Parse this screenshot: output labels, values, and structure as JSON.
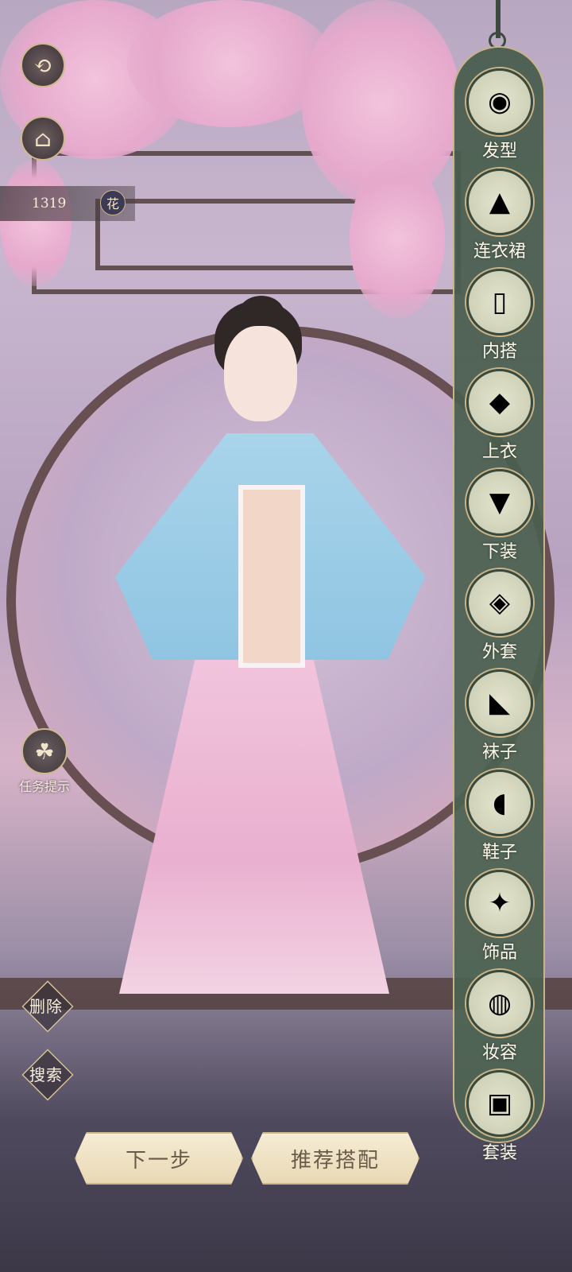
{
  "currency": {
    "amount": "1319",
    "icon_char": "花"
  },
  "left_controls": {
    "back_icon": "⟲",
    "shop_icon": "⌂"
  },
  "task_hint": {
    "label": "任务提示",
    "icon": "clover-icon"
  },
  "actions": {
    "delete": "删除",
    "search": "搜索"
  },
  "categories": [
    {
      "label": "发型",
      "icon": "hairstyle-icon",
      "glyph": "◉"
    },
    {
      "label": "连衣裙",
      "icon": "dress-icon",
      "glyph": "▲"
    },
    {
      "label": "内搭",
      "icon": "inner-wear-icon",
      "glyph": "▯"
    },
    {
      "label": "上衣",
      "icon": "top-icon",
      "glyph": "◆"
    },
    {
      "label": "下装",
      "icon": "skirt-icon",
      "glyph": "▼"
    },
    {
      "label": "外套",
      "icon": "coat-icon",
      "glyph": "◈"
    },
    {
      "label": "袜子",
      "icon": "socks-icon",
      "glyph": "◣"
    },
    {
      "label": "鞋子",
      "icon": "shoes-icon",
      "glyph": "◖"
    },
    {
      "label": "饰品",
      "icon": "accessory-icon",
      "glyph": "✦"
    },
    {
      "label": "妆容",
      "icon": "makeup-icon",
      "glyph": "◍"
    },
    {
      "label": "套装",
      "icon": "outfit-set-icon",
      "glyph": "▣"
    }
  ],
  "bottom_buttons": {
    "next": "下一步",
    "recommend": "推荐搭配"
  },
  "colors": {
    "panel": "#4f6652",
    "gold_border": "#c9b48a",
    "button_fill": "#f3e7cd"
  }
}
